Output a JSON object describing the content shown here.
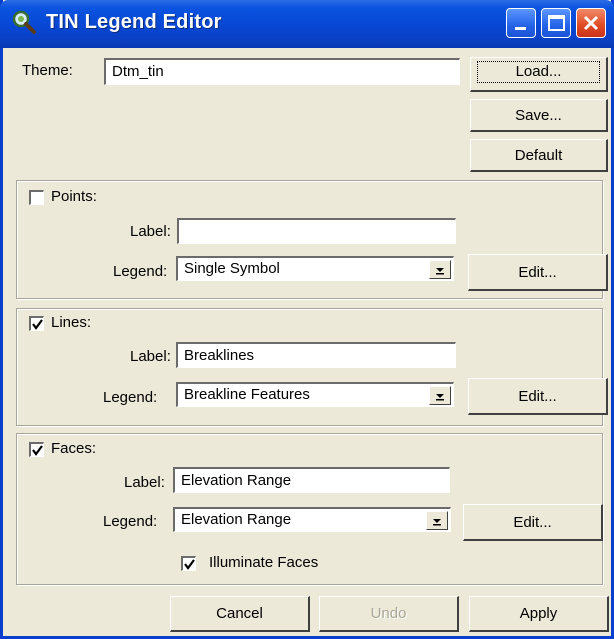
{
  "window": {
    "title": "TIN Legend Editor"
  },
  "theme": {
    "label": "Theme:",
    "value": "Dtm_tin"
  },
  "buttons": {
    "load": "Load...",
    "save": "Save...",
    "default": "Default",
    "cancel": "Cancel",
    "undo": "Undo",
    "apply": "Apply"
  },
  "points": {
    "title": "Points:",
    "checked": false,
    "label_caption": "Label:",
    "label_value": "",
    "legend_caption": "Legend:",
    "legend_value": "Single Symbol",
    "edit": "Edit..."
  },
  "lines": {
    "title": "Lines:",
    "checked": true,
    "label_caption": "Label:",
    "label_value": "Breaklines",
    "legend_caption": "Legend:",
    "legend_value": "Breakline Features",
    "edit": "Edit..."
  },
  "faces": {
    "title": "Faces:",
    "checked": true,
    "label_caption": "Label:",
    "label_value": "Elevation Range",
    "legend_caption": "Legend:",
    "legend_value": "Elevation Range",
    "edit": "Edit...",
    "illuminate_label": "Illuminate Faces",
    "illuminate_checked": true
  },
  "colors": {
    "title_bar": "#0a53e0",
    "dialog_bg": "#ece9d8",
    "close_button": "#e04a22"
  }
}
